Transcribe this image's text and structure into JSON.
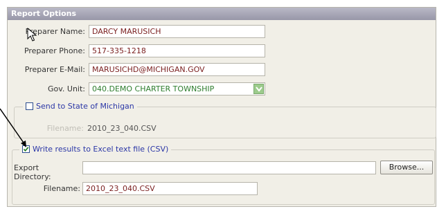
{
  "panel": {
    "title": "Report Options"
  },
  "preparer": {
    "name_label": "Preparer Name:",
    "name_value": "DARCY MARUSICH",
    "phone_label": "Preparer Phone:",
    "phone_value": "517-335-1218",
    "email_label": "Preparer E-Mail:",
    "email_value": "MARUSICHD@MICHIGAN.GOV",
    "unit_label": "Gov. Unit:",
    "unit_value": "040.DEMO CHARTER TOWNSHIP"
  },
  "state_group": {
    "checkbox_label": "Send to State of Michigan",
    "checked": false,
    "filename_label": "Filename:",
    "filename_value": "2010_23_040.CSV"
  },
  "excel_group": {
    "checkbox_label": "Write results to Excel text file (CSV)",
    "checked": true,
    "export_dir_label": "Export Directory:",
    "export_dir_value": "",
    "browse_label": "Browse...",
    "filename_label": "Filename:",
    "filename_value": "2010_23_040.CSV"
  },
  "colors": {
    "header": "#9fa0b3",
    "panel_bg": "#f1efe7",
    "value_text": "#7a1f1f",
    "combo_text": "#2d7d2d",
    "legend_text": "#2a36a6"
  },
  "icons": [
    "mouse-cursor-icon",
    "annotation-arrow-icon",
    "dropdown-arrow-icon",
    "checkmark-icon"
  ]
}
